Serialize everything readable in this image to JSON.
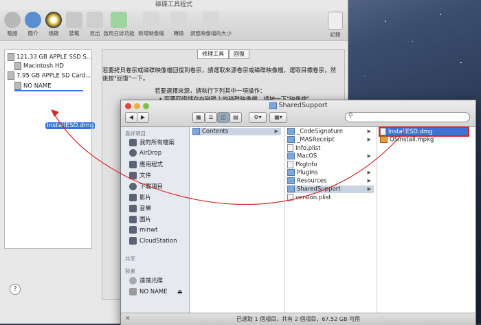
{
  "disk_utility": {
    "title": "磁碟工具程式",
    "toolbar": [
      "驗證",
      "簡介",
      "燒錄",
      "裝載",
      "退出",
      "啟用日誌功能",
      "新增映像檔",
      "轉換",
      "調整映像檔的大小",
      "記錄"
    ],
    "disks": [
      "121.33 GB APPLE SSD S...",
      "Macintosh HD",
      "7.95 GB APPLE SD Card...",
      "NO NAME"
    ],
    "tabs": [
      "修理工具",
      "回復"
    ],
    "text": [
      "若要拷貝卷宗或磁碟映像檔回復到卷宗，請選取來源卷宗或磁碟映像檔，選取目標卷宗，然",
      "後按\"回復\"一下。",
      "若要選擇來源，請執行下列其中一項操作：",
      "• 若要回復儲存在磁碟上的磁碟映像檔，請按一下\"映像檔\"。"
    ],
    "help": "?"
  },
  "drag_label": "InstallESD.dmg",
  "finder": {
    "title": "SharedSupport",
    "sidebar_headers": [
      "喜好項目",
      "共享",
      "裝置"
    ],
    "favorites": [
      "我的所有檔案",
      "AirDrop",
      "應用程式",
      "文件",
      "下載項目",
      "影片",
      "音樂",
      "圖片",
      "minwt",
      "CloudStation"
    ],
    "devices": [
      "遠端光碟",
      "NO NAME"
    ],
    "col1": [
      "Contents"
    ],
    "col2": [
      "_CodeSignature",
      "_MASReceipt",
      "Info.plist",
      "MacOS",
      "PkgInfo",
      "PlugIns",
      "Resources",
      "SharedSupport",
      "version.plist"
    ],
    "col3": [
      "InstallESD.dmg",
      "OSInstall.mpkg"
    ],
    "status": "已選取 1 個項目，共有 2 個項目，67.52 GB 可用"
  }
}
